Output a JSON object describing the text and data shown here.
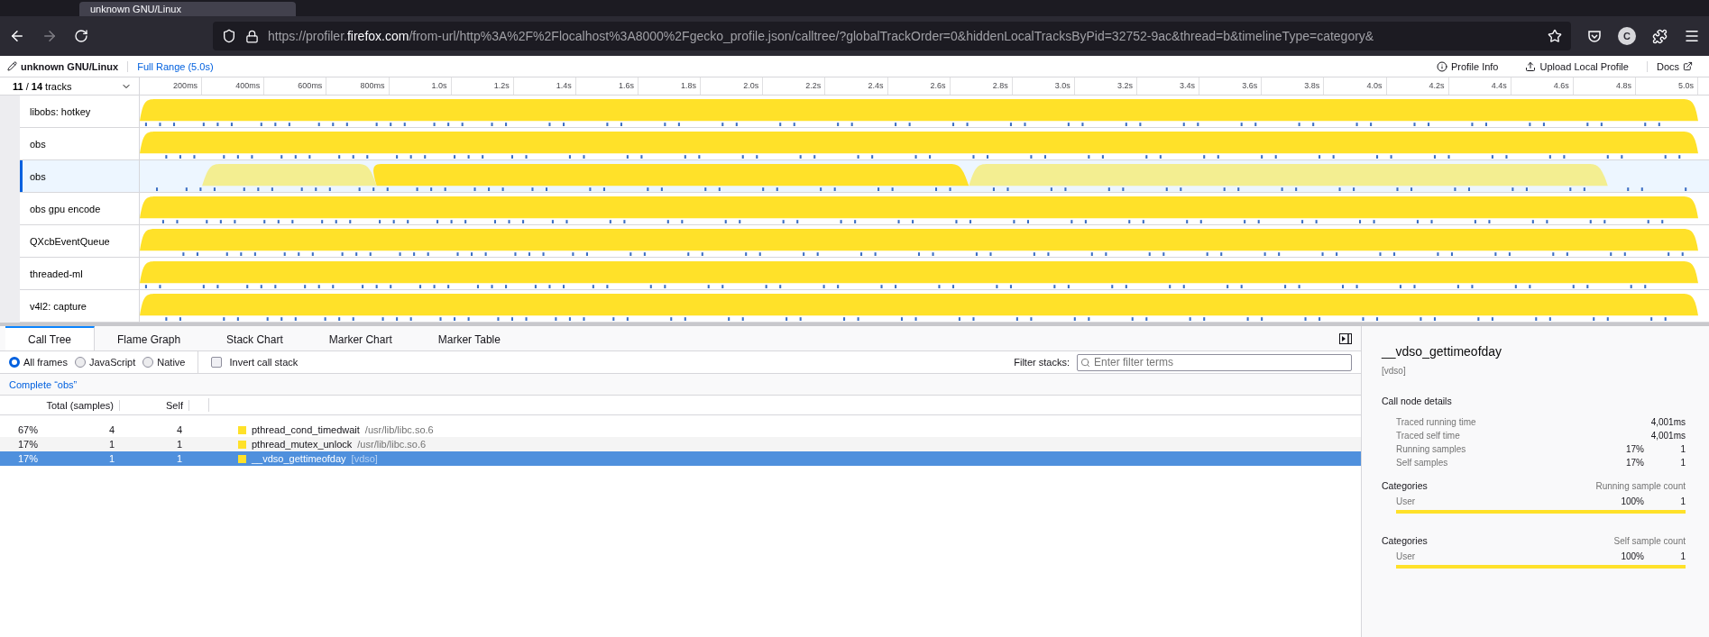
{
  "browser": {
    "tab_title": "unknown GNU/Linux",
    "url": {
      "scheme": "https://profiler.",
      "host": "firefox.com",
      "path": "/from-url/http%3A%2F%2Flocalhost%3A8000%2Fgecko_profile.json/calltree/?globalTrackOrder=0&hiddenLocalTracksByPid=32752-9ac&thread=b&timelineType=category&"
    },
    "account_initial": "C"
  },
  "profile": {
    "name": "unknown GNU/Linux",
    "range": "Full Range (5.0s)",
    "actions": [
      {
        "label": "Profile Info",
        "kind": "info"
      },
      {
        "label": "Upload Local Profile",
        "kind": "upload"
      },
      {
        "label": "Docs",
        "kind": "external"
      }
    ]
  },
  "timeline": {
    "track_count": "**11** / **14** tracks",
    "ticks": [
      "200ms",
      "400ms",
      "600ms",
      "800ms",
      "1.0s",
      "1.2s",
      "1.4s",
      "1.6s",
      "1.8s",
      "2.0s",
      "2.2s",
      "2.4s",
      "2.6s",
      "2.8s",
      "3.0s",
      "3.2s",
      "3.4s",
      "3.6s",
      "3.8s",
      "4.0s",
      "4.2s",
      "4.4s",
      "4.6s",
      "4.8s",
      "5.0s"
    ],
    "tracks": [
      {
        "name": "libobs: hotkey",
        "selected": false
      },
      {
        "name": "obs",
        "selected": false
      },
      {
        "name": "obs",
        "selected": true
      },
      {
        "name": "obs gpu encode",
        "selected": false
      },
      {
        "name": "QXcbEventQueue",
        "selected": false
      },
      {
        "name": "threaded-ml",
        "selected": false
      },
      {
        "name": "v4l2: capture",
        "selected": false
      }
    ]
  },
  "panel": {
    "tabs": [
      {
        "label": "Call Tree",
        "selected": true
      },
      {
        "label": "Flame Graph",
        "selected": false
      },
      {
        "label": "Stack Chart",
        "selected": false
      },
      {
        "label": "Marker Chart",
        "selected": false
      },
      {
        "label": "Marker Table",
        "selected": false
      }
    ],
    "frame_filters": [
      {
        "label": "All frames",
        "selected": true
      },
      {
        "label": "JavaScript",
        "selected": false
      },
      {
        "label": "Native",
        "selected": false
      }
    ],
    "invert": {
      "label": "Invert call stack",
      "checked": false
    },
    "filter": {
      "label": "Filter stacks:",
      "placeholder": "Enter filter terms"
    },
    "breadcrumb": "Complete “obs”",
    "columns": [
      "Total (samples)",
      "Self"
    ],
    "rows": [
      {
        "total_pct": "67%",
        "total": "4",
        "self": "4",
        "name": "pthread_cond_timedwait",
        "lib": "/usr/lib/libc.so.6",
        "selected": false
      },
      {
        "total_pct": "17%",
        "total": "1",
        "self": "1",
        "name": "pthread_mutex_unlock",
        "lib": "/usr/lib/libc.so.6",
        "selected": false
      },
      {
        "total_pct": "17%",
        "total": "1",
        "self": "1",
        "name": "__vdso_gettimeofday",
        "lib": "[vdso]",
        "selected": true
      }
    ]
  },
  "sidebar": {
    "title": "__vdso_gettimeofday",
    "lib": "[vdso]",
    "section": "Call node details",
    "details": [
      {
        "label": "Traced running time",
        "value": "4,001ms"
      },
      {
        "label": "Traced self time",
        "value": "4,001ms"
      },
      {
        "label": "Running samples",
        "pct": "17%",
        "value": "1"
      },
      {
        "label": "Self samples",
        "pct": "17%",
        "value": "1"
      }
    ],
    "categories": [
      {
        "title": "Categories",
        "column": "Running sample count",
        "items": [
          {
            "name": "User",
            "pct": "100%",
            "count": "1",
            "level": 1
          }
        ]
      },
      {
        "title": "Categories",
        "column": "Self sample count",
        "items": [
          {
            "name": "User",
            "pct": "100%",
            "count": "1",
            "level": 1
          }
        ]
      }
    ]
  }
}
